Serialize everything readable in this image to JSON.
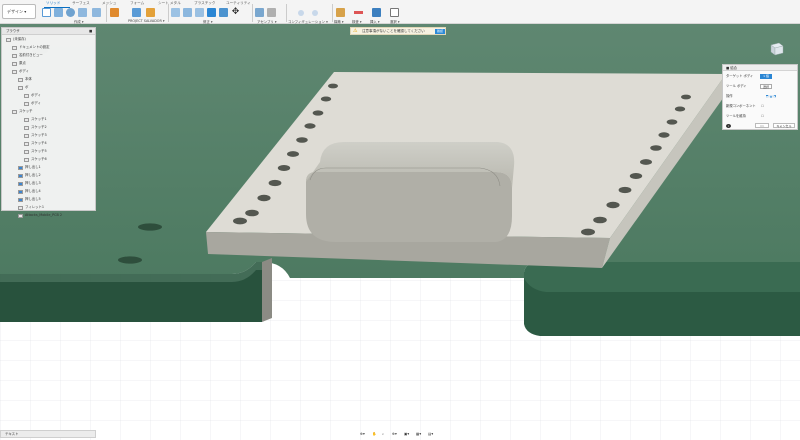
{
  "toolbar": {
    "workspace": "デザイン ▾",
    "tabs": [
      "ソリッド",
      "サーフェス",
      "メッシュ",
      "フォーム",
      "シート メタル",
      "プラスチック",
      "ユーティリティ"
    ],
    "groups": [
      "作成 ▾",
      "PROJECT SALVADOR ▾",
      "修正 ▾",
      "アセンブリ ▾",
      "コンフィギュレーション ▾",
      "構築 ▾",
      "検査 ▾",
      "挿入 ▾",
      "選択 ▾"
    ]
  },
  "warning": {
    "text": "注意事項がないことを確認してください",
    "button": "確認"
  },
  "browser": {
    "title": "ブラウザ",
    "items": [
      "(未保存)",
      "ドキュメントの設定",
      "名前付きビュー",
      "原点",
      "ボディ",
      "本体",
      "ボ",
      "ボディ",
      "ボディ",
      "スケッチ",
      "スケッチ1",
      "スケッチ2",
      "スケッチ3",
      "スケッチ4",
      "スケッチ5",
      "スケッチ6",
      "押し出し1",
      "押し出し2",
      "押し出し3",
      "押し出し4",
      "押し出し5",
      "フィレット1",
      "Attacks_Mobile_PCB 2"
    ]
  },
  "panel": {
    "title": "■ 結合",
    "rows": [
      {
        "label": "ターゲット ボディ",
        "control": "1 個"
      },
      {
        "label": "ツール ボディ",
        "control": "選択"
      },
      {
        "label": "操作",
        "control": "⬒ ⬓ ⬔"
      },
      {
        "label": "新規コンポーネント",
        "control": "☐"
      },
      {
        "label": "ツールを維持",
        "control": "☐"
      }
    ],
    "ok": "OK",
    "cancel": "キャンセル"
  },
  "viewcube": "前",
  "textcmd": "テキスト",
  "navbar": [
    "⊕▾",
    "✋",
    "⌕",
    "⊕▾",
    "▣▾",
    "▦▾",
    "▤▾"
  ],
  "colors": {
    "pcb": "#4d7a61",
    "pcb_edge": "#2f5c45",
    "body": "#d9d8d2",
    "body_side": "#a9a89f",
    "accent": "#0a6fc2"
  }
}
